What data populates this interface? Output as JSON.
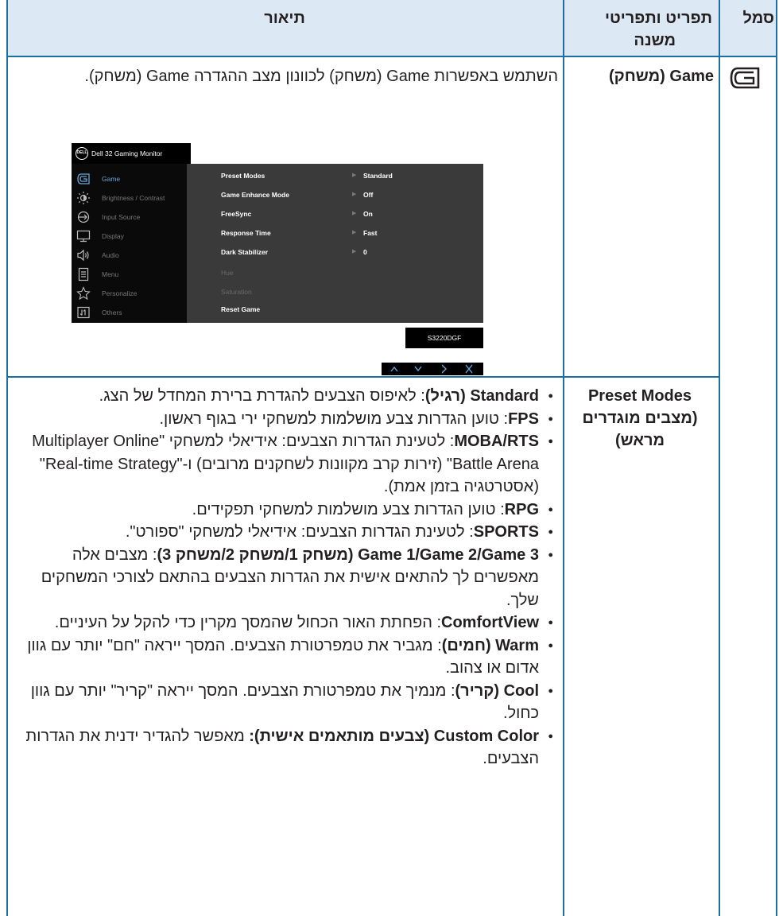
{
  "header": {
    "symbol": "סמל",
    "feature_line1": "תפריט ותפריטי",
    "feature_line2": "משנה",
    "description": "תיאור"
  },
  "game_row": {
    "icon": "game-icon",
    "feature": "Game (משחק)",
    "description": "השתמש באפשרות Game (משחק) לכוונון מצב ההגדרה Game (משחק).",
    "osd": {
      "title": "Dell 32 Gaming Monitor",
      "logo": "DELL",
      "menu": [
        {
          "label": "Game",
          "icon": "game-icon",
          "active": true
        },
        {
          "label": "Brightness / Contrast",
          "icon": "brightness-icon",
          "active": false
        },
        {
          "label": "Input Source",
          "icon": "input-source-icon",
          "active": false
        },
        {
          "label": "Display",
          "icon": "display-icon",
          "active": false
        },
        {
          "label": "Audio",
          "icon": "audio-icon",
          "active": false
        },
        {
          "label": "Menu",
          "icon": "menu-icon",
          "active": false
        },
        {
          "label": "Personalize",
          "icon": "star-icon",
          "active": false
        },
        {
          "label": "Others",
          "icon": "others-icon",
          "active": false
        }
      ],
      "settings": [
        {
          "label": "Preset Modes",
          "value": "Standard"
        },
        {
          "label": "Game Enhance Mode",
          "value": "Off"
        },
        {
          "label": "FreeSync",
          "value": "On"
        },
        {
          "label": "Response Time",
          "value": "Fast"
        },
        {
          "label": "Dark Stabilizer",
          "value": "0"
        },
        {
          "label": "Hue",
          "value": ""
        },
        {
          "label": "Saturation",
          "value": ""
        },
        {
          "label": "Reset Game",
          "value": ""
        }
      ],
      "model": "S3220DGF",
      "nav_buttons": [
        "^",
        "v",
        ">",
        "X"
      ]
    }
  },
  "preset_row": {
    "feature_line1": "Preset Modes",
    "feature_line2": "(מצבים מוגדרים",
    "feature_line3": "מראש)",
    "modes": [
      {
        "name": "Standard (רגיל)",
        "sep": ": ",
        "text": "לאיפוס הצבעים להגדרת ברירת המחדל של הצג."
      },
      {
        "name": "FPS",
        "sep": ": ",
        "text": "טוען הגדרות צבע מושלמות למשחקי ירי בגוף ראשון."
      },
      {
        "name": "MOBA/RTS",
        "sep": ": ",
        "text": "לטעינת הגדרות הצבעים: אידיאלי למשחקי \"Multiplayer Online Battle Arena\" (זירות קרב מקוונות לשחקנים מרובים) ו-\"Real-time Strategy\" (אסטרטגיה בזמן אמת)."
      },
      {
        "name": "RPG",
        "sep": ": ",
        "text": "טוען הגדרות צבע מושלמות למשחקי תפקידים."
      },
      {
        "name": "SPORTS",
        "sep": ": ",
        "text": "לטעינת הגדרות הצבעים: אידיאלי למשחקי \"ספורט\"."
      },
      {
        "name": "Game 1/Game 2/Game 3 (משחק 1/משחק 2/משחק 3)",
        "sep": ": ",
        "text": "מצבים אלה מאפשרים לך להתאים אישית את הגדרות הצבעים בהתאם לצורכי המשחקים שלך."
      },
      {
        "name": "ComfortView",
        "sep": ": ",
        "text": "הפחתת האור הכחול שהמסך מקרין כדי להקל על העיניים."
      },
      {
        "name": "Warm (חמים)",
        "sep": ": ",
        "text": "מגביר את טמפרטורת הצבעים. המסך ייראה \"חם\" יותר עם גוון אדום או צהוב."
      },
      {
        "name": "Cool (קריר)",
        "sep": ": ",
        "text": "מנמיך את טמפרטורת הצבעים. המסך ייראה \"קריר\" יותר עם גוון כחול."
      },
      {
        "name": "Custom Color (צבעים מותאמים אישית):",
        "sep": " ",
        "text": "מאפשר להגדיר ידנית את הגדרות הצבעים."
      }
    ]
  },
  "colors": {
    "border": "#1c6ea4",
    "header_bg": "#dce8f4",
    "osd_accent": "#6aa6d8"
  }
}
